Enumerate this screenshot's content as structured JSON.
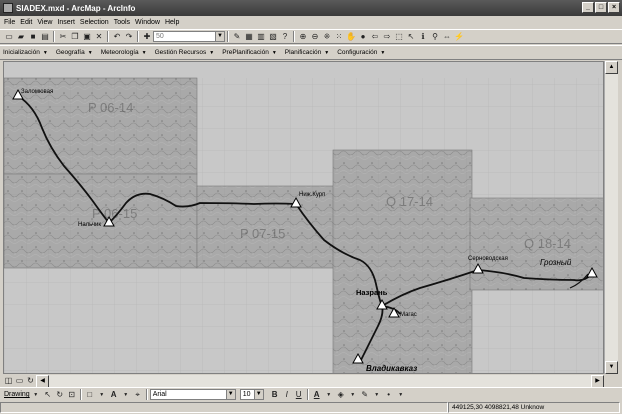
{
  "window": {
    "title": "SIADEX.mxd - ArcMap - ArcInfo"
  },
  "title_buttons": [
    "_",
    "□",
    "×"
  ],
  "menu": [
    "File",
    "Edit",
    "View",
    "Insert",
    "Selection",
    "Tools",
    "Window",
    "Help"
  ],
  "scale_combo": "50",
  "siadex_menu": [
    "Inicialización",
    "Geografía",
    "Meteorología",
    "Gestión Recursos",
    "PrePlanificación",
    "Planificación",
    "Configuración"
  ],
  "map": {
    "sheets": [
      "P 06-14",
      "P 06-15",
      "P 07-15",
      "Q 17-14",
      "Q 18-14"
    ],
    "places": [
      "Заломювая",
      "Нальчик",
      "Ниж.Курп",
      "Назрань",
      "Магас",
      "Владикавказ",
      "Серноводская",
      "Грозный"
    ]
  },
  "drawing": {
    "label": "Drawing",
    "font": "Arial",
    "size": "10",
    "bold": "B",
    "italic": "I",
    "underline": "U",
    "font_color": "A"
  },
  "status": {
    "coords": "449125,30  4098821,48 Unknow"
  }
}
